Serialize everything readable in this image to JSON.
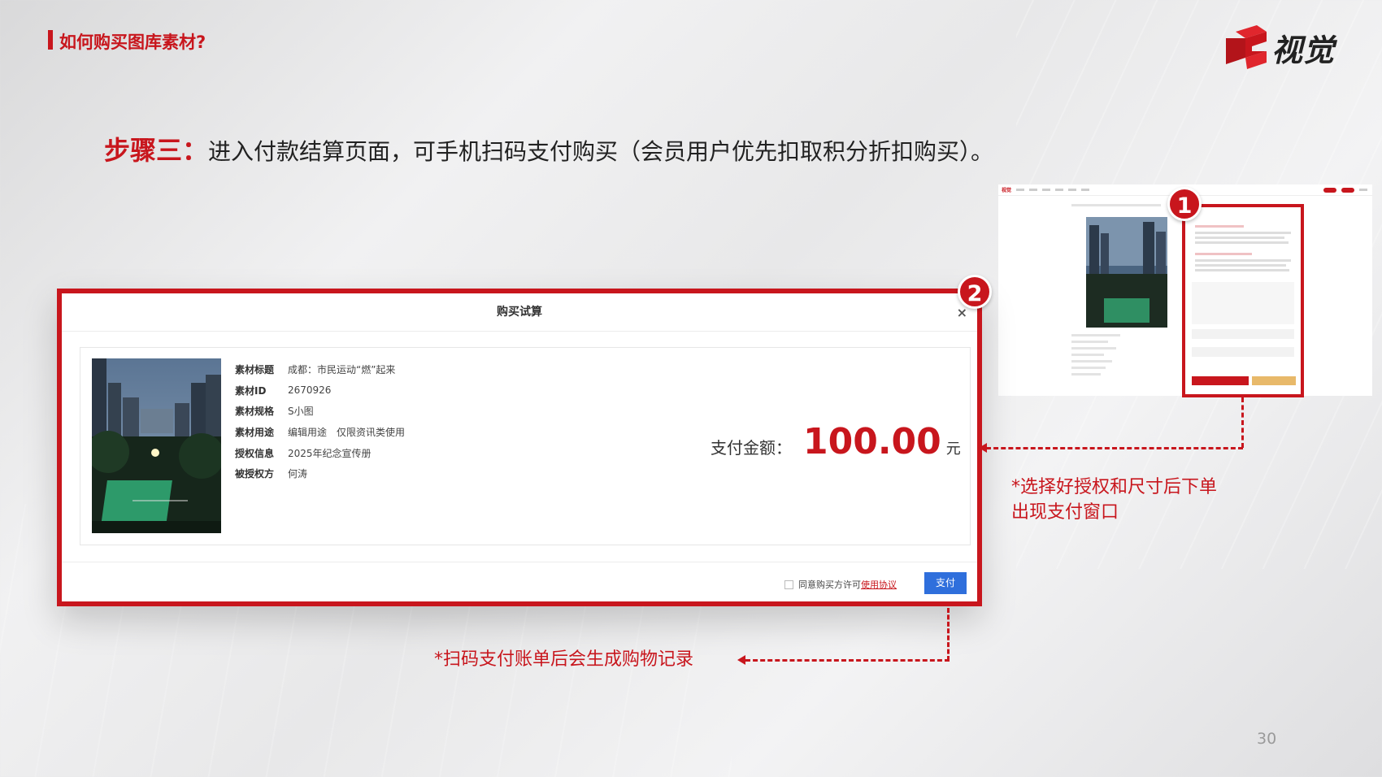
{
  "header": {
    "title": "如何购买图库素材?",
    "logo_text": "视觉"
  },
  "step": {
    "label": "步骤三：",
    "text": "进入付款结算页面，可手机扫码支付购买（会员用户优先扣取积分折扣购买）。"
  },
  "dialog": {
    "title": "购买试算",
    "close": "×",
    "fields": [
      {
        "key": "素材标题",
        "value": "成都：市民运动“燃”起来"
      },
      {
        "key": "素材ID",
        "value": "2670926"
      },
      {
        "key": "素材规格",
        "value": "S小图"
      },
      {
        "key": "素材用途",
        "value": "编辑用途　仅限资讯类使用"
      },
      {
        "key": "授权信息",
        "value": "2025年纪念宣传册"
      },
      {
        "key": "被授权方",
        "value": "何涛"
      }
    ],
    "pay_label": "支付金额：",
    "pay_value": "100.00",
    "pay_unit": "元",
    "agree_text": "同意购买方许可",
    "agree_link": "使用协议",
    "pay_button": "支付"
  },
  "badges": {
    "one": "1",
    "two": "2"
  },
  "notes": {
    "right_line1": "*选择好授权和尺寸后下单",
    "right_line2": "出现支付窗口",
    "bottom": "*扫码支付账单后会生成购物记录"
  },
  "page_number": "30",
  "colors": {
    "accent": "#c8161d",
    "button": "#2f6fdc"
  }
}
